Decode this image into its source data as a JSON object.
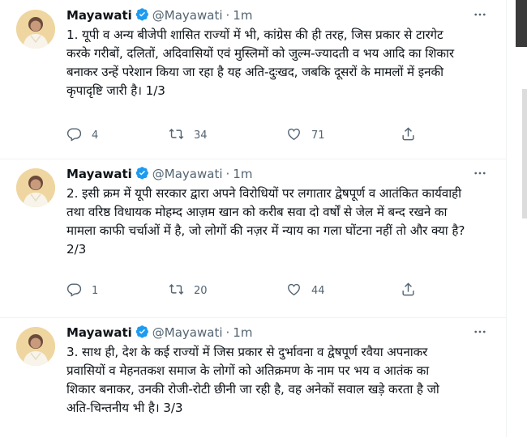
{
  "tweets": [
    {
      "name": "Mayawati",
      "handle": "@Mayawati",
      "dot": "·",
      "time": "1m",
      "text": "1. यूपी व अन्य बीजेपी शासित राज्यों में भी, कांग्रेस की ही तरह, जिस प्रकार से टारगेट\nकरके गरीबों, दलितों, अदिवासियों एवं मुस्लिमों को जुल्म-ज्यादती व भय आदि का शिकार\nबनाकर उन्हें परेशान किया जा रहा है यह अति-दुःखद, जबकि दूसरों के मामलों में इनकी\nकृपादृष्टि जारी है। 1/3",
      "replies": "4",
      "retweets": "34",
      "likes": "71"
    },
    {
      "name": "Mayawati",
      "handle": "@Mayawati",
      "dot": "·",
      "time": "1m",
      "text": "2. इसी क्रम में यूपी सरकार द्वारा अपने विरोधियों पर लगातार द्वेषपूर्ण व आतंकित कार्यवाही\nतथा वरिष्ठ विधायक मोहम्द आज़म खान को करीब सवा दो वर्षों से जेल में बन्द रखने का\nमामला काफी चर्चाओं में है, जो लोगों की नज़र में न्याय का गला घोंटना नहीं तो और क्या है?\n2/3",
      "replies": "1",
      "retweets": "20",
      "likes": "44"
    },
    {
      "name": "Mayawati",
      "handle": "@Mayawati",
      "dot": "·",
      "time": "1m",
      "text": "3. साथ ही, देश के कई राज्यों में जिस प्रकार से दुर्भावना व द्वेषपूर्ण रवैया अपनाकर\nप्रवासियों व मेहनतकश समाज के लोगों को अतिक्रमण के नाम पर भय व आतंक का\nशिकार बनाकर, उनकी रोजी-रोटी छीनी जा रही है, वह अनेकों सवाल खड़े करता है जो\nअति-चिन्तनीय भी है। 3/3"
    }
  ],
  "icons": {
    "verified": "verified-badge-icon",
    "more": "more-horizontal-icon",
    "reply": "reply-icon",
    "retweet": "retweet-icon",
    "like": "heart-icon",
    "share": "share-icon"
  },
  "colors": {
    "verified": "#1d9bf0",
    "secondary_text": "#536471",
    "primary_text": "#0f1419",
    "divider": "#eff3f4"
  }
}
